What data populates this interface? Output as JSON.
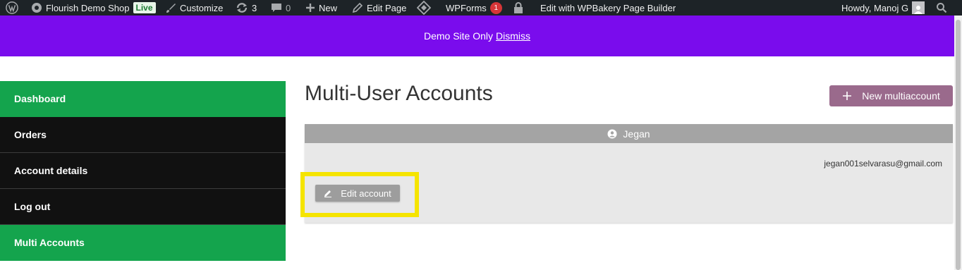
{
  "adminbar": {
    "site_name": "Flourish Demo Shop",
    "live_badge": "Live",
    "customize": "Customize",
    "updates_count": "3",
    "comments_count": "0",
    "new_label": "New",
    "edit_page": "Edit Page",
    "wpforms": "WPForms",
    "wpforms_count": "1",
    "wpbakery": "Edit with WPBakery Page Builder",
    "howdy": "Howdy, Manoj G"
  },
  "notice": {
    "text": "Demo Site Only",
    "dismiss": "Dismiss"
  },
  "nav": {
    "items": [
      {
        "label": "Dashboard",
        "active": true
      },
      {
        "label": "Orders",
        "active": false
      },
      {
        "label": "Account details",
        "active": false
      },
      {
        "label": "Log out",
        "active": false
      },
      {
        "label": "Multi Accounts",
        "active": true
      }
    ]
  },
  "main": {
    "title": "Multi-User Accounts",
    "new_button": "New multiaccount",
    "account": {
      "name": "Jegan",
      "email": "jegan001selvarasu@gmail.com",
      "edit_button": "Edit account"
    }
  },
  "colors": {
    "adminbar": "#1d2327",
    "notice": "#7a0ced",
    "nav_active": "#14a44d",
    "nav_default": "#111111",
    "new_button": "#9a6a8c",
    "card_header": "#a4a4a4",
    "highlight": "#f5e400"
  }
}
